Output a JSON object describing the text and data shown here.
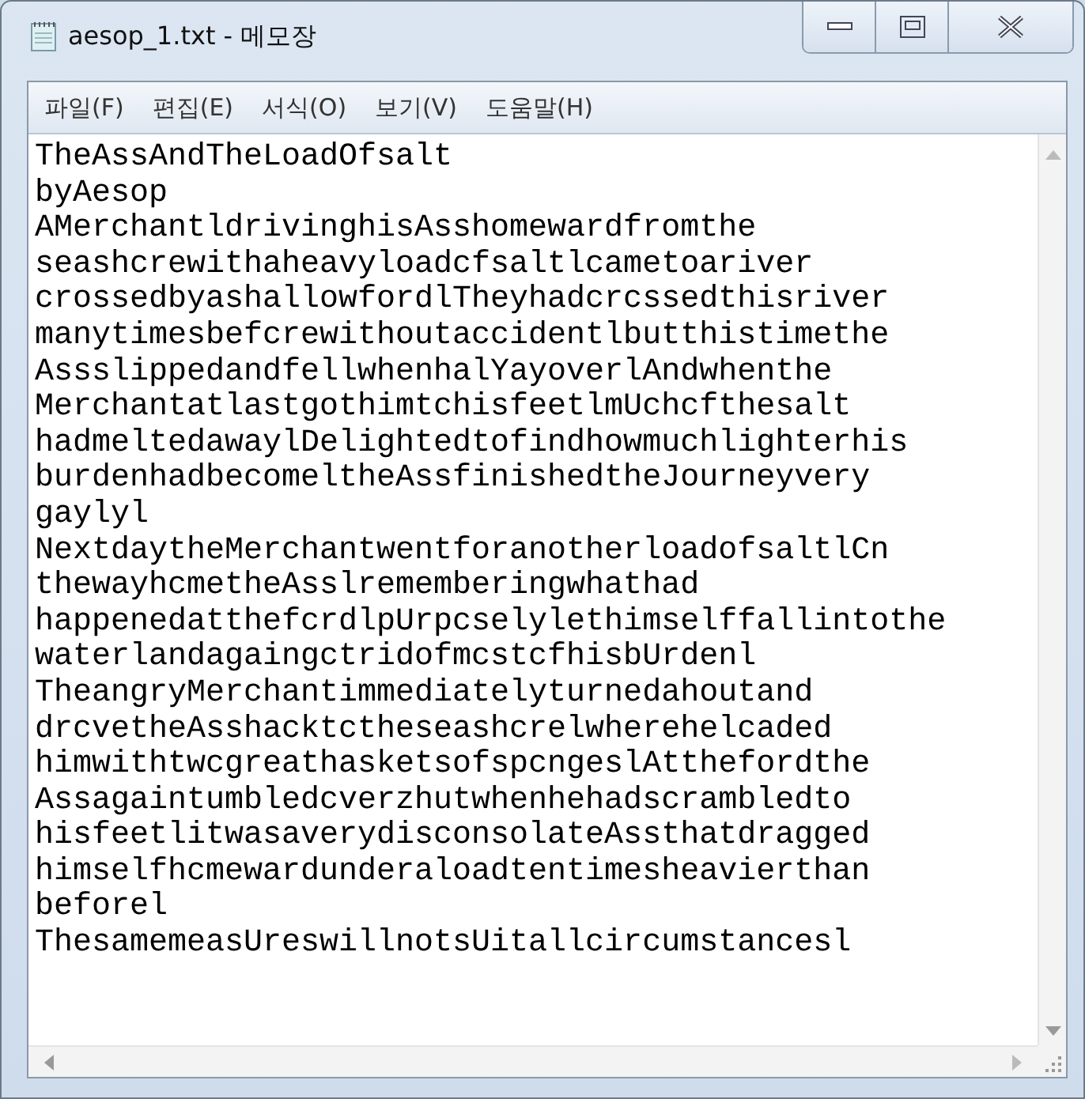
{
  "window": {
    "title": "aesop_1.txt - 메모장"
  },
  "menu": [
    "파일(F)",
    "편집(E)",
    "서식(O)",
    "보기(V)",
    "도움말(H)"
  ],
  "lines": [
    "TheAssAndTheLoadOfsalt",
    "byAesop",
    "AMerchantldrivinghisAsshomewardfromthe",
    "seashcrewithaheavyloadcfsaltlcametoariver",
    "crossedbyashallowfordlTheyhadcrcssedthisriver",
    "manytimesbefcrewithoutaccidentlbutthistimethe",
    "AssslippedandfellwhenhalYayoverlAndwhenthe",
    "MerchantatlastgothimtchisfeetlmUchcfthesalt",
    "hadmeltedawaylDelightedtofindhowmuchlighterhis",
    "burdenhadbecomeltheAssfinishedtheJourneyvery",
    "gaylyl",
    "NextdaytheMerchantwentforanotherloadofsaltlCn",
    "thewayhcmetheAsslrememberingwhathad",
    "happenedatthefcrdlpUrpcselylethimselffallintothe",
    "waterlandagaingctridofmcstcfhisbUrdenl",
    "TheangryMerchantimmediatelyturnedahoutand",
    "drcvetheAsshacktctheseashcrelwherehelcaded",
    "himwithtwcgreathasketsofspcngeslAtthefordthe",
    "Assagaintumbledcverzhutwhenhehadscrambledto",
    "hisfeetlitwasaverydisconsolateAssthatdragged",
    "himselfhcmewardunderaloadtentimesheavierthan",
    "beforel",
    "ThesamemeasUreswillnotsUitallcircumstancesl"
  ]
}
